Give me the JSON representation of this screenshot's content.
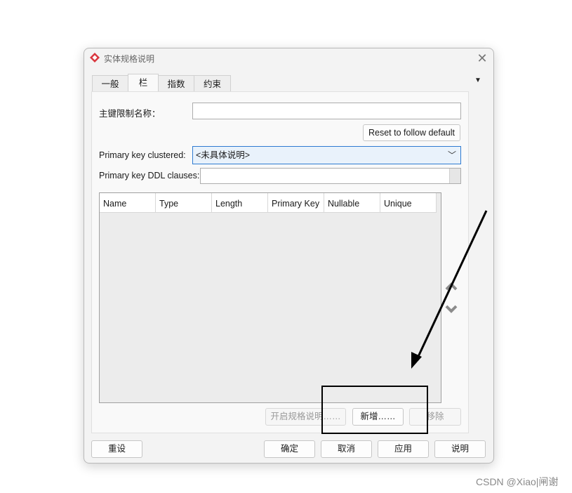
{
  "dialog": {
    "title": "实体规格说明",
    "close_glyph": "✕"
  },
  "tabs": [
    {
      "label": "一般"
    },
    {
      "label": "栏",
      "active": true
    },
    {
      "label": "指数"
    },
    {
      "label": "约束"
    }
  ],
  "tab_menu_glyph": "▼",
  "form": {
    "pk_name_label": "主键限制名称：",
    "pk_name_value": "",
    "reset_button": "Reset to follow default",
    "clustered_label": "Primary key clustered:",
    "clustered_value": "<未具体说明>",
    "ddl_label": "Primary key DDL clauses:",
    "ddl_value": ""
  },
  "grid": {
    "columns": [
      "Name",
      "Type",
      "Length",
      "Primary Key",
      "Nullable",
      "Unique"
    ],
    "rows": []
  },
  "move_up_icon": "chevron-up-icon",
  "move_down_icon": "chevron-down-icon",
  "grid_actions": {
    "open_spec": "开启规格说明……",
    "add": "新增……",
    "remove": "移除"
  },
  "footer": {
    "reset": "重设",
    "ok": "确定",
    "cancel": "取消",
    "apply": "应用",
    "help": "说明"
  },
  "watermark": "CSDN @Xiao|闸谢",
  "colors": {
    "accent": "#2f7bd1",
    "app_icon": "#d9363e",
    "annotation": "#000000"
  }
}
